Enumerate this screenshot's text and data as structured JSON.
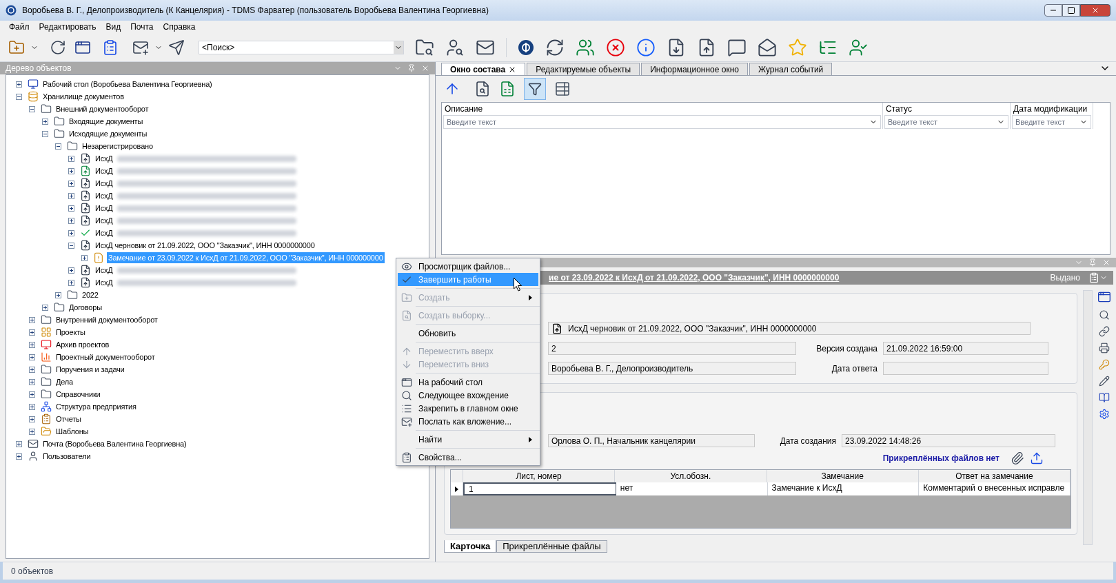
{
  "window": {
    "title": "Воробьева В. Г., Делопроизводитель (К Канцелярия) - TDMS Фарватер (пользователь Воробьева Валентина Георгиевна)"
  },
  "menu": [
    "Файл",
    "Редактировать",
    "Вид",
    "Почта",
    "Справка"
  ],
  "search": {
    "value": "<Поиск>"
  },
  "tree_panel": {
    "title": "Дерево объектов",
    "items": [
      {
        "kind": "desktop",
        "label": "Рабочий стол (Воробьева Валентина Георгиевна)",
        "expanded": false,
        "selected": false
      },
      {
        "kind": "storage",
        "label": "Хранилище документов",
        "expanded": true,
        "selected": false,
        "children": [
          {
            "kind": "folder",
            "label": "Внешний документооборот",
            "expanded": true,
            "selected": false,
            "children": [
              {
                "kind": "folder",
                "label": "Входящие документы",
                "expanded": false,
                "selected": false
              },
              {
                "kind": "folder",
                "label": "Исходящие документы",
                "expanded": true,
                "selected": false,
                "children": [
                  {
                    "kind": "folder",
                    "label": "Незарегистрировано",
                    "expanded": true,
                    "selected": false,
                    "children": [
                      {
                        "kind": "document",
                        "label": "ИсхД",
                        "blurred": true,
                        "expanded": false,
                        "selected": false
                      },
                      {
                        "kind": "document-sent",
                        "label": "ИсхД",
                        "blurred": true,
                        "expanded": false,
                        "selected": false
                      },
                      {
                        "kind": "document",
                        "label": "ИсхД",
                        "blurred": true,
                        "expanded": false,
                        "selected": false
                      },
                      {
                        "kind": "document",
                        "label": "ИсхД",
                        "blurred": true,
                        "expanded": false,
                        "selected": false
                      },
                      {
                        "kind": "document",
                        "label": "ИсхД",
                        "blurred": true,
                        "expanded": false,
                        "selected": false
                      },
                      {
                        "kind": "document",
                        "label": "ИсхД",
                        "blurred": true,
                        "expanded": false,
                        "selected": false
                      },
                      {
                        "kind": "document-approved",
                        "label": "ИсхД",
                        "blurred": true,
                        "expanded": false,
                        "selected": false
                      },
                      {
                        "kind": "document",
                        "label": "ИсхД  черновик от 21.09.2022, ООО \"Заказчик\", ИНН 0000000000",
                        "blurred": false,
                        "expanded": true,
                        "selected": false,
                        "children": [
                          {
                            "kind": "remark",
                            "label": "Замечание от 23.09.2022 к ИсхД от 21.09.2022, ООО \"Заказчик\", ИНН 000000000",
                            "blurred": false,
                            "expanded": false,
                            "selected": true
                          }
                        ]
                      },
                      {
                        "kind": "document",
                        "label": "ИсхД",
                        "blurred": true,
                        "expanded": false,
                        "selected": false
                      },
                      {
                        "kind": "document",
                        "label": "ИсхД",
                        "blurred": true,
                        "expanded": false,
                        "selected": false
                      }
                    ]
                  },
                  {
                    "kind": "folder",
                    "label": "2022",
                    "expanded": false,
                    "selected": false
                  }
                ]
              },
              {
                "kind": "folder",
                "label": "Договоры",
                "expanded": false,
                "selected": false
              }
            ]
          },
          {
            "kind": "folder",
            "label": "Внутренний документооборот",
            "expanded": false,
            "selected": false
          },
          {
            "kind": "projects",
            "label": "Проекты",
            "expanded": false,
            "selected": false
          },
          {
            "kind": "archive",
            "label": "Архив проектов",
            "expanded": false,
            "selected": false
          },
          {
            "kind": "chart",
            "label": "Проектный документооборот",
            "expanded": false,
            "selected": false
          },
          {
            "kind": "folder",
            "label": "Поручения и задачи",
            "expanded": false,
            "selected": false
          },
          {
            "kind": "folder",
            "label": "Дела",
            "expanded": false,
            "selected": false
          },
          {
            "kind": "folder",
            "label": "Справочники",
            "expanded": false,
            "selected": false
          },
          {
            "kind": "structure",
            "label": "Структура предприятия",
            "expanded": false,
            "selected": false
          },
          {
            "kind": "reports",
            "label": "Отчеты",
            "expanded": false,
            "selected": false
          },
          {
            "kind": "templates",
            "label": "Шаблоны",
            "expanded": false,
            "selected": false
          }
        ]
      },
      {
        "kind": "mail",
        "label": "Почта (Воробьева Валентина Георгиевна)",
        "expanded": false,
        "selected": false
      },
      {
        "kind": "users",
        "label": "Пользователи",
        "expanded": false,
        "selected": false
      }
    ]
  },
  "content_tabs": [
    {
      "label": "Окно состава",
      "selected": true
    },
    {
      "label": "Редактируемые объекты",
      "selected": false
    },
    {
      "label": "Информационное окно",
      "selected": false
    },
    {
      "label": "Журнал событий",
      "selected": false
    }
  ],
  "content_toolbar": {
    "filter_active": true
  },
  "grid": {
    "columns": [
      {
        "label": "Описание",
        "placeholder": "Введите текст"
      },
      {
        "label": "Статус",
        "placeholder": "Введите текст"
      },
      {
        "label": "Дата модификации",
        "placeholder": "Введите текст"
      }
    ]
  },
  "card": {
    "title": "ие от 23.09.2022 к ИсхД от 21.09.2022, ООО \"Заказчик\", ИНН 0000000000",
    "status": "Выдано",
    "document": "ИсхД  черновик от 21.09.2022, ООО \"Заказчик\", ИНН 0000000000",
    "version": "2",
    "version_created_label": "Версия создана",
    "version_created": "21.09.2022 16:59:00",
    "author": "Воробьева В. Г., Делопроизводитель",
    "answer_date_label": "Дата ответа",
    "reviewer": "Орлова О. П., Начальник канцелярии",
    "created_label": "Дата создания",
    "created": "23.09.2022 14:48:26",
    "attachments_note": "Прикреплённых файлов нет",
    "table": {
      "columns": [
        "Лист, номер",
        "Усл.обозн.",
        "Замечание",
        "Ответ на замечание"
      ],
      "rows": [
        {
          "cells": [
            "1",
            "нет",
            "Замечание к ИсхД",
            "Комментарий о внесенных исправле"
          ],
          "selected": true
        }
      ]
    },
    "tabs": [
      {
        "label": "Карточка",
        "selected": true
      },
      {
        "label": "Прикреплённые файлы",
        "selected": false
      }
    ]
  },
  "context_menu": {
    "items": [
      {
        "kind": "item",
        "label": "Просмотрщик файлов...",
        "disabled": false,
        "selected": false,
        "submenu": false
      },
      {
        "kind": "item",
        "label": "Завершить работы",
        "disabled": false,
        "selected": true,
        "submenu": false
      },
      {
        "kind": "separator"
      },
      {
        "kind": "item",
        "label": "Создать",
        "disabled": true,
        "selected": false,
        "submenu": true
      },
      {
        "kind": "separator"
      },
      {
        "kind": "item",
        "label": "Создать выборку...",
        "disabled": true,
        "selected": false,
        "submenu": false
      },
      {
        "kind": "separator"
      },
      {
        "kind": "item",
        "label": "Обновить",
        "disabled": false,
        "selected": false,
        "submenu": false
      },
      {
        "kind": "separator"
      },
      {
        "kind": "item",
        "label": "Переместить вверх",
        "disabled": true,
        "selected": false,
        "submenu": false
      },
      {
        "kind": "item",
        "label": "Переместить вниз",
        "disabled": true,
        "selected": false,
        "submenu": false
      },
      {
        "kind": "separator"
      },
      {
        "kind": "item",
        "label": "На рабочий стол",
        "disabled": false,
        "selected": false,
        "submenu": false
      },
      {
        "kind": "item",
        "label": "Следующее вхождение",
        "disabled": false,
        "selected": false,
        "submenu": false
      },
      {
        "kind": "item",
        "label": "Закрепить в главном окне",
        "disabled": false,
        "selected": false,
        "submenu": false
      },
      {
        "kind": "item",
        "label": "Послать как вложение...",
        "disabled": false,
        "selected": false,
        "submenu": false
      },
      {
        "kind": "separator"
      },
      {
        "kind": "item",
        "label": "Найти",
        "disabled": false,
        "selected": false,
        "submenu": true
      },
      {
        "kind": "separator"
      },
      {
        "kind": "item",
        "label": "Свойства...",
        "disabled": false,
        "selected": false,
        "submenu": false
      }
    ]
  },
  "status_bar": {
    "text": "0 объектов"
  }
}
